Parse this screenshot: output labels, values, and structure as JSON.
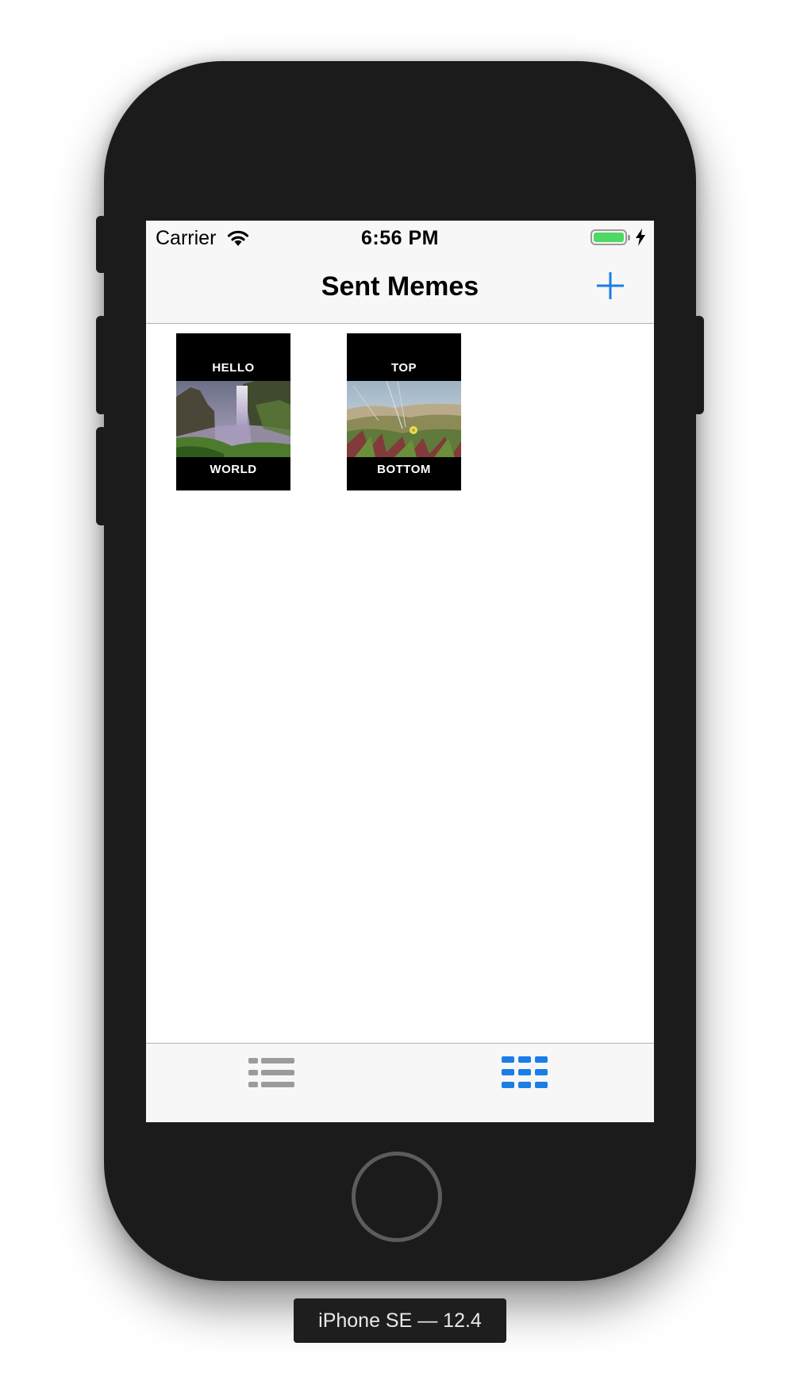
{
  "status_bar": {
    "carrier": "Carrier",
    "time": "6:56 PM",
    "battery_level": 1.0
  },
  "nav": {
    "title": "Sent Memes",
    "add_icon": "plus-icon"
  },
  "memes": [
    {
      "top": "HELLO",
      "bottom": "WORLD",
      "image": "waterfall-landscape"
    },
    {
      "top": "TOP",
      "bottom": "BOTTOM",
      "image": "dune-grass-flowers"
    }
  ],
  "tabs": [
    {
      "icon": "list-icon",
      "selected": false
    },
    {
      "icon": "grid-icon",
      "selected": true
    }
  ],
  "device_label": "iPhone SE — 12.4",
  "colors": {
    "accent": "#1a7ee6",
    "inactive": "#9b9b9b",
    "battery": "#4cd964"
  }
}
